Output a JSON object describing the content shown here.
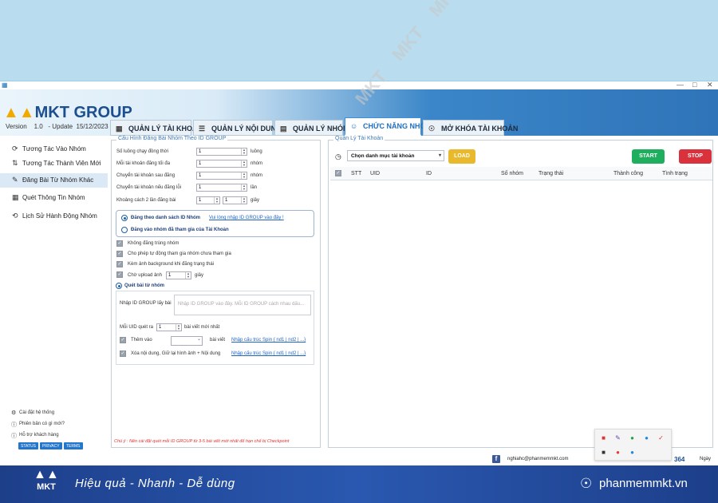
{
  "app": {
    "brand": "MKT GROUP",
    "version_label": "Version",
    "version": "1.0",
    "update_label": "- Update",
    "update_date": "15/12/2023"
  },
  "tabs": [
    {
      "label": "QUẢN LÝ TÀI KHOẢN",
      "icon": "calendar-icon"
    },
    {
      "label": "QUẢN LÝ NỘI DUNG",
      "icon": "list-icon"
    },
    {
      "label": "QUẢN LÝ NHÓM",
      "icon": "window-icon"
    },
    {
      "label": "CHỨC NĂNG NHÓM",
      "icon": "group-icon",
      "active": true
    },
    {
      "label": "MỞ KHÓA TÀI KHOẢN",
      "icon": "wifi-icon"
    }
  ],
  "sidebar": {
    "items": [
      {
        "label": "Tương Tác Vào Nhóm"
      },
      {
        "label": "Tương Tác Thành Viên Mới"
      },
      {
        "label": "Đăng Bài Từ Nhóm Khác",
        "active": true
      },
      {
        "label": "Quét Thông Tin Nhóm"
      },
      {
        "label": "Lịch Sử Hành Động Nhóm"
      }
    ],
    "footer": [
      {
        "label": "Cài đặt hệ thống"
      },
      {
        "label": "Phiên bản có gì mới?"
      },
      {
        "label": "Hỗ trợ khách hàng"
      }
    ],
    "badges": [
      "STATUS",
      "PRIVACY",
      "TERMS"
    ]
  },
  "config": {
    "title": "Cấu Hình Đăng Bài Nhóm Theo ID GROUP",
    "rows": [
      {
        "label": "Số luồng chạy đồng thời",
        "value": "1",
        "unit": "luồng"
      },
      {
        "label": "Mỗi tài khoản đăng tối đa",
        "value": "1",
        "unit": "nhóm"
      },
      {
        "label": "Chuyển tài khoản sau đăng",
        "value": "1",
        "unit": "nhóm"
      },
      {
        "label": "Chuyển tài khoản nếu đăng lỗi",
        "value": "1",
        "unit": "lần"
      },
      {
        "label": "Khoảng cách 2 lần đăng bài",
        "value": "1",
        "value2": "1",
        "unit": "giây"
      }
    ],
    "radio1": "Đăng theo danh sách ID Nhóm",
    "radio1_link": "Vui lòng nhập ID GROUP vào đây !",
    "radio2": "Đăng vào nhóm đã tham gia của Tài Khoản",
    "checks": [
      "Không đăng trùng nhóm",
      "Cho phép tự động tham gia nhóm chưa tham gia",
      "Kèm ảnh background khi đăng trạng thái"
    ],
    "upload_label": "Chờ upload ảnh",
    "upload_value": "1",
    "upload_unit": "giây",
    "scan_radio": "Quét bài từ nhóm",
    "group_id_label": "Nhập ID GROUP lấy bài",
    "group_id_placeholder": "Nhập ID GROUP vào đây. Mỗi ID GROUP cách nhau dấu...",
    "uid_label": "Mỗi UID quét ra",
    "uid_value": "1",
    "uid_unit": "bài viết mới nhất",
    "add_label": "Thêm vào",
    "add_unit": "bài viết",
    "spin_link1": "Nhập cấu trúc Spin { nd1 | nd2 | ...}",
    "delete_label": "Xóa nội dung, Giữ lại hình ảnh + Nội dung",
    "spin_link2": "Nhập cấu trúc Spin { nd1 | nd2 | ...}",
    "note": "Chú ý : Nên cài đặt quét mỗi ID GROUP từ 3-5 bài viết mới nhất để hạn chế bị Checkpoint"
  },
  "accounts": {
    "title": "Quản Lý Tài Khoản",
    "select_value": "Chọn danh mục tài khoản",
    "load_label": "LOAD",
    "start_label": "START",
    "stop_label": "STOP",
    "columns": [
      "STT",
      "UID",
      "ID",
      "Số nhóm",
      "Trạng thái",
      "Thành công",
      "Tình trạng"
    ]
  },
  "statusbar": {
    "email": "nghiahc@phanmemmkt.com",
    "count": "364",
    "day": "Ngày"
  },
  "watermark": "MKT",
  "footer": {
    "logo": "MKT",
    "tagline": "Hiệu quả - Nhanh - Dễ dùng",
    "website": "phanmemmkt.vn"
  },
  "colors": {
    "load": "#e8b92c",
    "start": "#1fae5d",
    "stop": "#d9323c",
    "footer": "#2a58b0"
  }
}
